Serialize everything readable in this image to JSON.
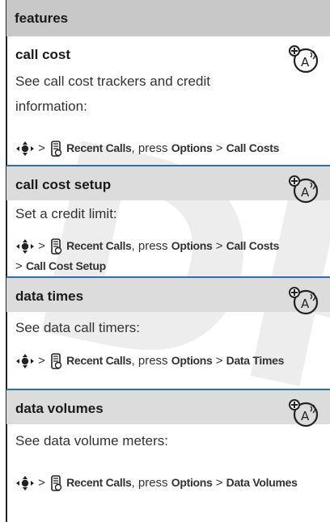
{
  "watermark": "DR",
  "header": {
    "title": "features"
  },
  "sections": [
    {
      "title": "call cost",
      "icon": "network-feature-icon",
      "description": "See call cost trackers and credit information:",
      "path": {
        "start": "Recent Calls",
        "mid": ", press ",
        "options": "Options",
        "target": "Call Costs",
        "extra": ""
      }
    },
    {
      "title": "call cost setup",
      "icon": "network-feature-icon",
      "description": "Set a credit limit:",
      "path": {
        "start": "Recent Calls",
        "mid": ", press ",
        "options": "Options",
        "target": "Call Costs",
        "extra": "Call Cost Setup"
      }
    },
    {
      "title": "data times",
      "icon": "network-feature-icon",
      "description": "See data call timers:",
      "path": {
        "start": "Recent Calls",
        "mid": ", press ",
        "options": "Options",
        "target": "Data Times",
        "extra": ""
      }
    },
    {
      "title": "data volumes",
      "icon": "network-feature-icon",
      "description": "See data volume meters:",
      "path": {
        "start": "Recent Calls",
        "mid": ", press ",
        "options": "Options",
        "target": "Data Volumes",
        "extra": ""
      }
    }
  ],
  "colors": {
    "header_bg": "#c8c8c8",
    "title_bg": "#dcdcdc",
    "separator": "#2f6fb0"
  }
}
